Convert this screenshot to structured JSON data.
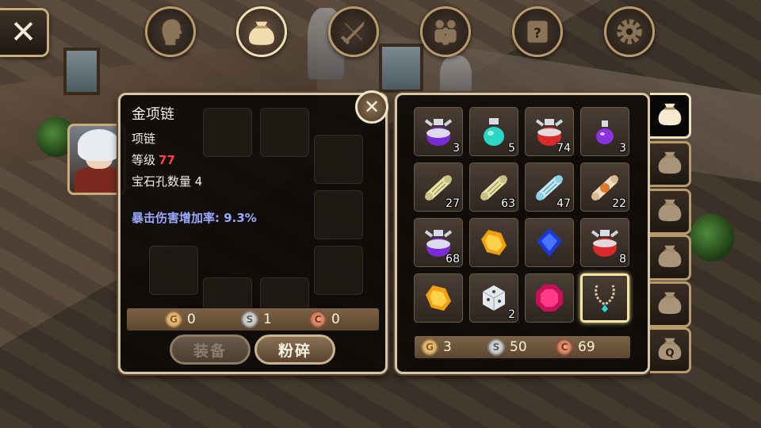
{
  "nav": {
    "close_icon": "close-icon",
    "buttons": [
      {
        "name": "character",
        "icon": "head-icon"
      },
      {
        "name": "bag",
        "icon": "bag-icon",
        "active": true
      },
      {
        "name": "skills",
        "icon": "sword-icon"
      },
      {
        "name": "party",
        "icon": "party-icon"
      },
      {
        "name": "quests",
        "icon": "scroll-icon"
      },
      {
        "name": "settings",
        "icon": "gear-icon"
      }
    ]
  },
  "detail": {
    "title": "金项链",
    "type": "项链",
    "level_label": "等级",
    "level_value": "77",
    "sockets": "宝石孔数量 4",
    "bonus": "暴击伤害增加率: 9.3%",
    "price": {
      "gold": "0",
      "silver": "1",
      "copper": "0"
    },
    "equip_label": "装备",
    "smash_label": "粉碎"
  },
  "inventory": {
    "items": [
      {
        "icon": "purple-potion-icon",
        "qty": "3"
      },
      {
        "icon": "teal-potion-icon",
        "qty": "5"
      },
      {
        "icon": "red-potion-icon",
        "qty": "74"
      },
      {
        "icon": "small-purple-potion-icon",
        "qty": "3"
      },
      {
        "icon": "yellow-scroll-icon",
        "qty": "27"
      },
      {
        "icon": "yellow-scroll-icon",
        "qty": "63"
      },
      {
        "icon": "blue-scroll-icon",
        "qty": "47"
      },
      {
        "icon": "orange-scroll-icon",
        "qty": "22"
      },
      {
        "icon": "purple-potion-icon",
        "qty": "68"
      },
      {
        "icon": "amber-gem-icon",
        "qty": ""
      },
      {
        "icon": "sapphire-gem-icon",
        "qty": ""
      },
      {
        "icon": "red-potion-icon",
        "qty": "8"
      },
      {
        "icon": "amber-gem-icon",
        "qty": ""
      },
      {
        "icon": "dice-icon",
        "qty": "2"
      },
      {
        "icon": "ruby-gem-icon",
        "qty": ""
      },
      {
        "icon": "necklace-icon",
        "qty": "",
        "selected": true
      }
    ],
    "money": {
      "gold": "3",
      "silver": "50",
      "copper": "69"
    }
  },
  "tabs": [
    {
      "icon": "bag-icon",
      "active": true
    },
    {
      "icon": "bag-icon"
    },
    {
      "icon": "bag-icon"
    },
    {
      "icon": "bag-icon"
    },
    {
      "icon": "bag-icon"
    },
    {
      "icon": "quest-bag-icon",
      "label": "Q"
    }
  ],
  "colors": {
    "level": "#ff4040",
    "bonus": "#9ba9ff",
    "panel_border": "#d8c7a5"
  }
}
